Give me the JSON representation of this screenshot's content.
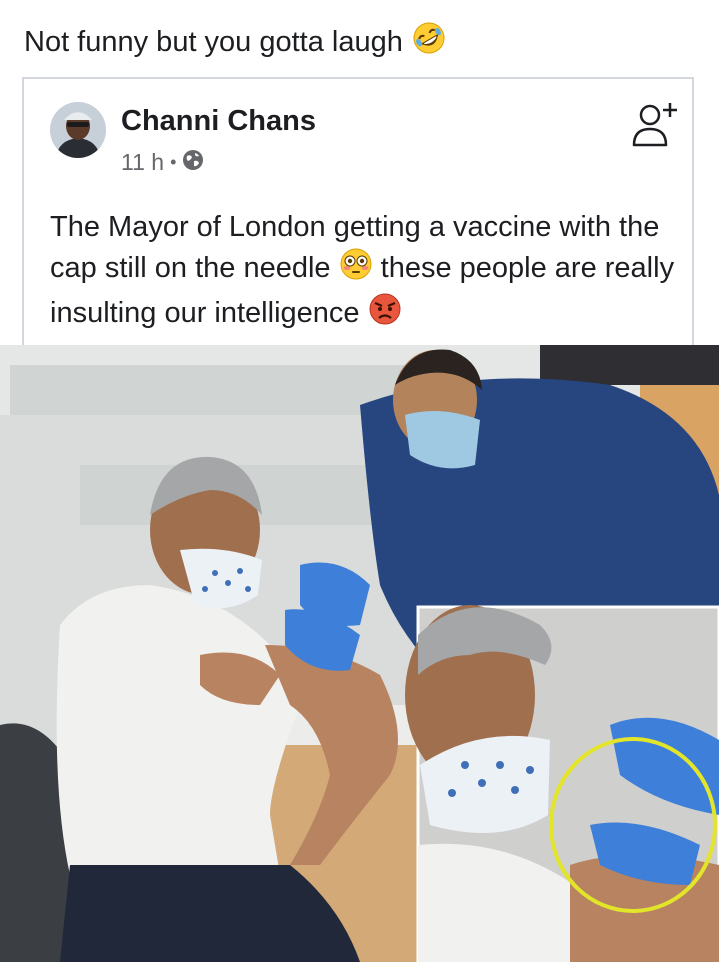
{
  "caption": {
    "text": "Not funny but you gotta laugh",
    "emoji": "rolling-on-floor-laughing-emoji"
  },
  "post": {
    "author": "Channi Chans",
    "time": "11 h",
    "separator": "•",
    "privacy_icon": "globe-icon",
    "follow_icon": "add-friend-icon",
    "text_part1": "The Mayor of London getting a vaccine with the cap still on the needle",
    "emoji_1": "flushed-face-emoji",
    "text_part2": "these people are really insulting our intelligence",
    "emoji_2": "angry-face-emoji"
  },
  "photo": {
    "inset_highlight_color": "#e3e52a",
    "glove_color": "#3d7fd9"
  }
}
